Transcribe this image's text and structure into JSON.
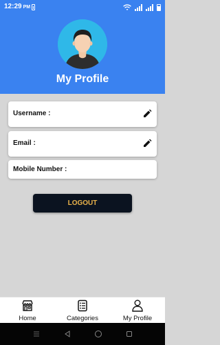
{
  "status_bar": {
    "time": "12:29",
    "ampm": "PM"
  },
  "header": {
    "title": "My Profile",
    "background_color": "#3a82f0",
    "avatar_icon": "user-avatar-icon"
  },
  "fields": {
    "username_label": "Username :",
    "email_label": "Email :",
    "mobile_label": "Mobile Number :"
  },
  "logout": {
    "label": "LOGOUT",
    "background_color": "#0b1320",
    "text_color": "#e9b24a"
  },
  "bottom_nav": {
    "home_label": "Home",
    "categories_label": "Categories",
    "profile_label": "My Profile"
  },
  "icons": {
    "edit": "pencil-icon",
    "home": "store-icon",
    "categories": "list-icon",
    "profile": "person-icon"
  }
}
